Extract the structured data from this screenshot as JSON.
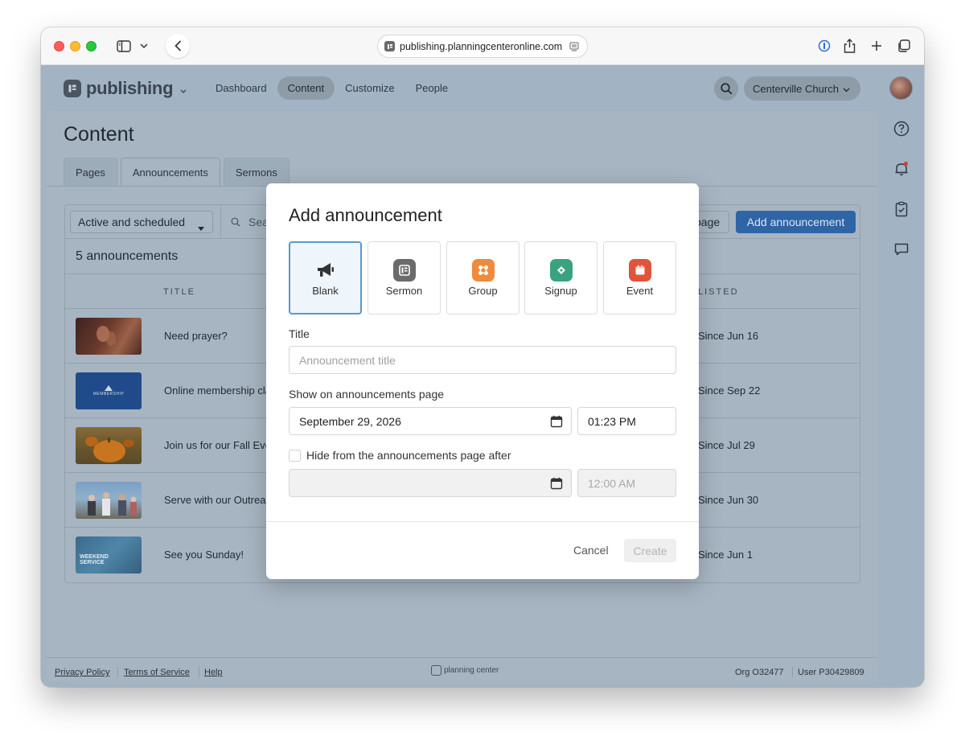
{
  "browser": {
    "url": "publishing.planningcenteronline.com"
  },
  "app": {
    "name": "publishing",
    "nav": [
      {
        "label": "Dashboard",
        "active": false
      },
      {
        "label": "Content",
        "active": true
      },
      {
        "label": "Customize",
        "active": false
      },
      {
        "label": "People",
        "active": false
      }
    ],
    "org": "Centerville Church"
  },
  "content": {
    "title": "Content",
    "tabs": [
      {
        "label": "Pages",
        "active": false
      },
      {
        "label": "Announcements",
        "active": true
      },
      {
        "label": "Sermons",
        "active": false
      }
    ],
    "filter": "Active and scheduled",
    "search_placeholder": "Sea",
    "page_button": "page",
    "add_button": "Add announcement",
    "count": "5 announcements",
    "columns": {
      "title": "TITLE",
      "listed": "LISTED"
    },
    "rows": [
      {
        "title": "Need prayer?",
        "listed": "Since Jun 16",
        "thumb": "prayer"
      },
      {
        "title": "Online membership cla",
        "listed": "Since Sep 22",
        "thumb": "membership",
        "thumb_text": "MEMBERSHIP"
      },
      {
        "title": "Join us for our Fall Eve",
        "listed": "Since Jul 29",
        "thumb": "pumpkin"
      },
      {
        "title": "Serve with our Outreac",
        "listed": "Since Jun 30",
        "thumb": "outreach"
      },
      {
        "title": "See you Sunday!",
        "listed": "Since Jun 1",
        "thumb": "weekend",
        "thumb_text": "WEEKEND SERVICE"
      }
    ]
  },
  "footer": {
    "links": [
      "Privacy Policy",
      "Terms of Service",
      "Help"
    ],
    "brand": "planning center",
    "org_id": "Org O32477",
    "user_id": "User P30429809"
  },
  "modal": {
    "title": "Add announcement",
    "types": [
      {
        "label": "Blank",
        "icon": "megaphone-icon",
        "selected": true
      },
      {
        "label": "Sermon",
        "icon": "sermon-icon",
        "color": "#6b6b6b"
      },
      {
        "label": "Group",
        "icon": "group-icon",
        "color": "#f08a3c"
      },
      {
        "label": "Signup",
        "icon": "signup-icon",
        "color": "#3aa37e"
      },
      {
        "label": "Event",
        "icon": "event-icon",
        "color": "#e0553a"
      }
    ],
    "title_label": "Title",
    "title_placeholder": "Announcement title",
    "show_label": "Show on announcements page",
    "show_date": "September 29, 2026",
    "show_time": "01:23 PM",
    "hide_label": "Hide from the announcements page after",
    "hide_checked": false,
    "hide_date": "",
    "hide_time": "12:00 AM",
    "cancel": "Cancel",
    "create": "Create"
  }
}
